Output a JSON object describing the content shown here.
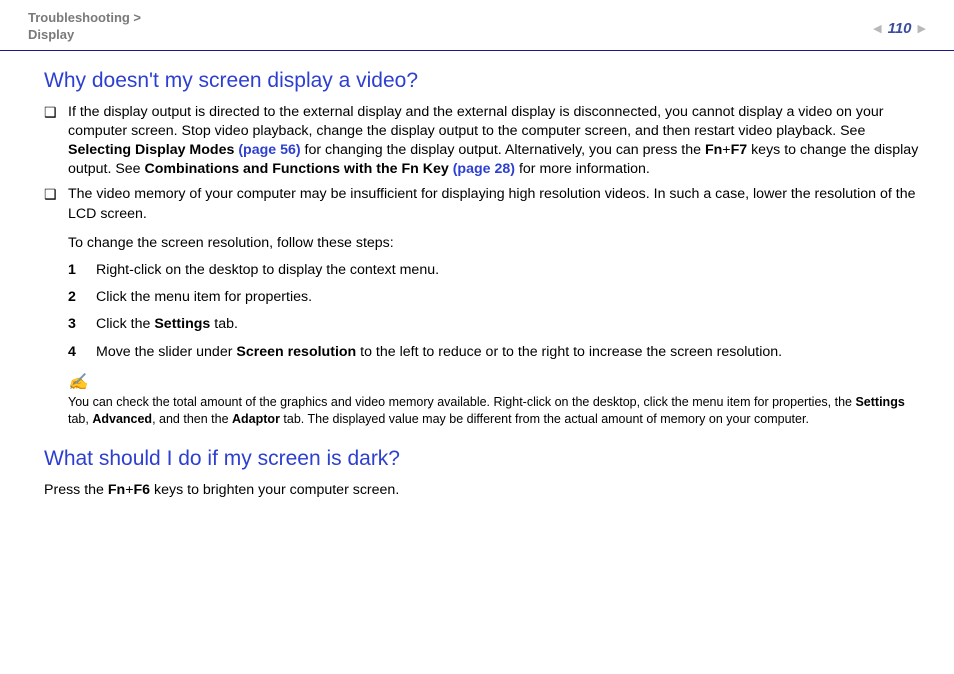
{
  "header": {
    "breadcrumb_line1": "Troubleshooting >",
    "breadcrumb_line2": "Display",
    "page_number": "110"
  },
  "section1": {
    "heading": "Why doesn't my screen display a video?",
    "bullet1_pre": "If the display output is directed to the external display and the external display is disconnected, you cannot display a video on your computer screen. Stop video playback, change the display output to the computer screen, and then restart video playback. See ",
    "bullet1_bold1": "Selecting Display Modes ",
    "bullet1_link1": "(page 56)",
    "bullet1_mid": " for changing the display output. Alternatively, you can press the ",
    "bullet1_fn": "Fn",
    "bullet1_plus": "+",
    "bullet1_f7": "F7",
    "bullet1_mid2": " keys to change the display output. See ",
    "bullet1_bold2": "Combinations and Functions with the Fn Key ",
    "bullet1_link2": "(page 28)",
    "bullet1_post": " for more information.",
    "bullet2": "The video memory of your computer may be insufficient for displaying high resolution videos. In such a case, lower the resolution of the LCD screen.",
    "steps_intro": "To change the screen resolution, follow these steps:",
    "step1": "Right-click on the desktop to display the context menu.",
    "step2": "Click the menu item for properties.",
    "step3_pre": "Click the ",
    "step3_bold": "Settings",
    "step3_post": " tab.",
    "step4_pre": "Move the slider under ",
    "step4_bold": "Screen resolution",
    "step4_post": " to the left to reduce or to the right to increase the screen resolution.",
    "note_icon": "✍",
    "note_pre": "You can check the total amount of the graphics and video memory available. Right-click on the desktop, click the menu item for properties, the ",
    "note_b1": "Settings",
    "note_mid1": " tab, ",
    "note_b2": "Advanced",
    "note_mid2": ", and then the ",
    "note_b3": "Adaptor",
    "note_post": " tab. The displayed value may be different from the actual amount of memory on your computer."
  },
  "section2": {
    "heading": "What should I do if my screen is dark?",
    "para_pre": "Press the ",
    "para_fn": "Fn",
    "para_plus": "+",
    "para_f6": "F6",
    "para_post": " keys to brighten your computer screen."
  },
  "numbers": {
    "n1": "1",
    "n2": "2",
    "n3": "3",
    "n4": "4"
  }
}
